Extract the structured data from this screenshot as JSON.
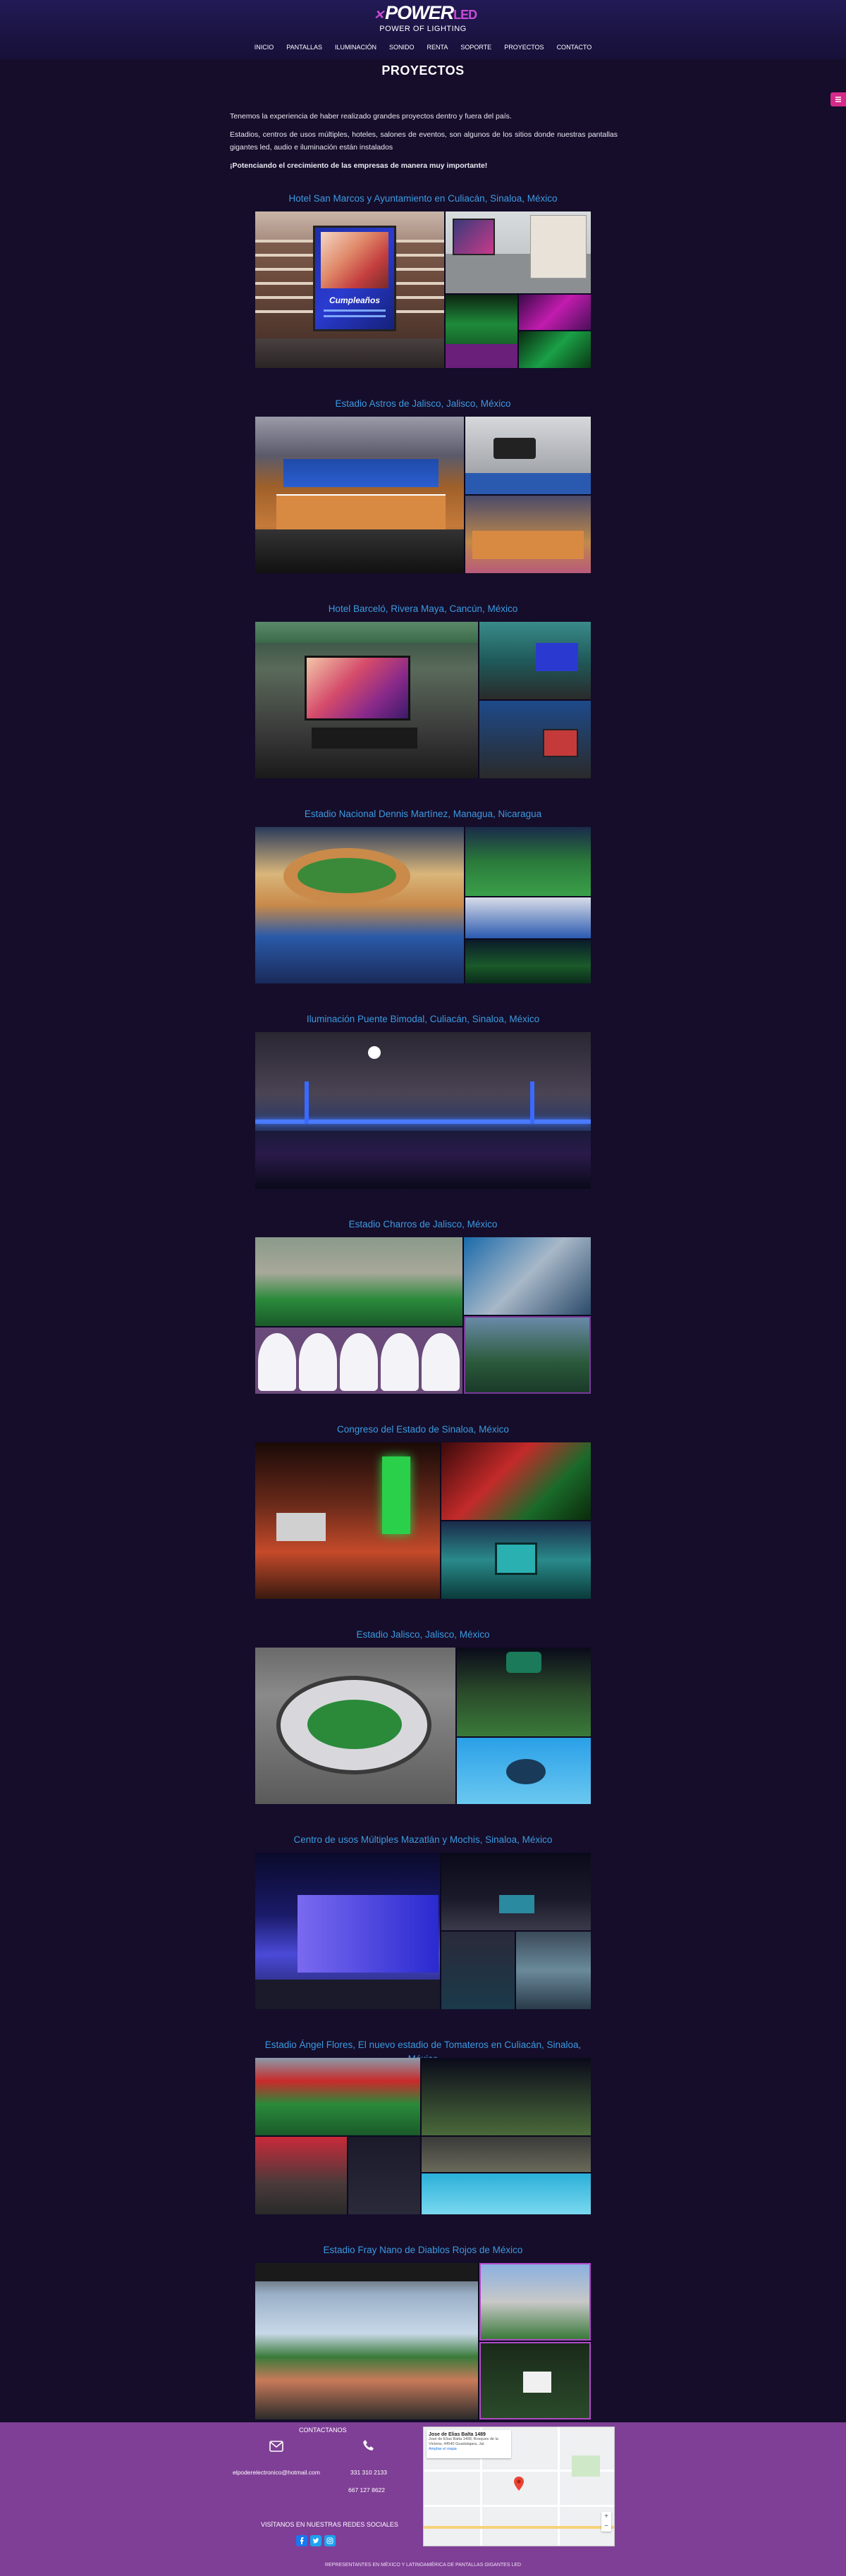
{
  "brand": {
    "logo_name": "POWER",
    "logo_led": "LED",
    "logo_tagline": "POWER OF LIGHTING"
  },
  "nav": [
    "INICIO",
    "PANTALLAS",
    "ILUMINACIÓN",
    "SONIDO",
    "RENTA",
    "SOPORTE",
    "PROYECTOS",
    "CONTACTO"
  ],
  "page_title": "PROYECTOS",
  "intro": {
    "p1": "Tenemos la experiencia de haber realizado grandes proyectos dentro y fuera del país.",
    "p2": "Estadios, centros de usos múltiples, hoteles, salones de eventos, son algunos de los sitios donde nuestras pantallas gigantes led, audio e iluminación están instalados",
    "p3": "¡Potenciando el crecimiento de las empresas de manera muy importante!"
  },
  "projects": [
    {
      "title": "Hotel San Marcos y Ayuntamiento en Culiacán, Sinaloa, México",
      "screen_text": "Cumpleaños"
    },
    {
      "title": "Estadio Astros de Jalisco, Jalisco, México"
    },
    {
      "title": "Hotel Barceló, Rivera Maya, Cancún, México"
    },
    {
      "title": "Estadio Nacional Dennis Martínez, Managua, Nicaragua"
    },
    {
      "title": "Iluminación Puente Bimodal, Culiacán, Sinaloa, México"
    },
    {
      "title": "Estadio Charros de Jalisco, México"
    },
    {
      "title": "Congreso del Estado de Sinaloa, México"
    },
    {
      "title": "Estadio Jalisco, Jalisco, México"
    },
    {
      "title": "Centro de usos Múltiples Mazatlán y Mochis, Sinaloa, México"
    },
    {
      "title": "Estadio Ángel Flores, El nuevo estadio de Tomateros en Culiacán, Sinaloa, México"
    },
    {
      "title": "Estadio Fray Nano de Diablos Rojos de México"
    }
  ],
  "footer": {
    "contact_label": "CONTACTANOS",
    "email": "elpoderelectronico@hotmail.com",
    "phone1": "331 310 2133",
    "phone2": "667 127 8622",
    "social_label": "VISÍTANOS EN NUESTRAS REDES SOCIALES",
    "bottom": "REPRESENTANTES EN MÉXICO Y LATINOAMÉRICA DE PANTALLAS GIGANTES LED",
    "map": {
      "place": "Jose de Elias Balta 1489",
      "address": "José de Elías Balta 1489, Bosques de la Victoria, 44540 Guadalajara, Jal.",
      "link": "Ampliar el mapa"
    }
  },
  "colors": {
    "background": "#150d2a",
    "project_title": "#3c9ae0",
    "footer": "#7f3f96",
    "accent": "#c84bd6"
  }
}
